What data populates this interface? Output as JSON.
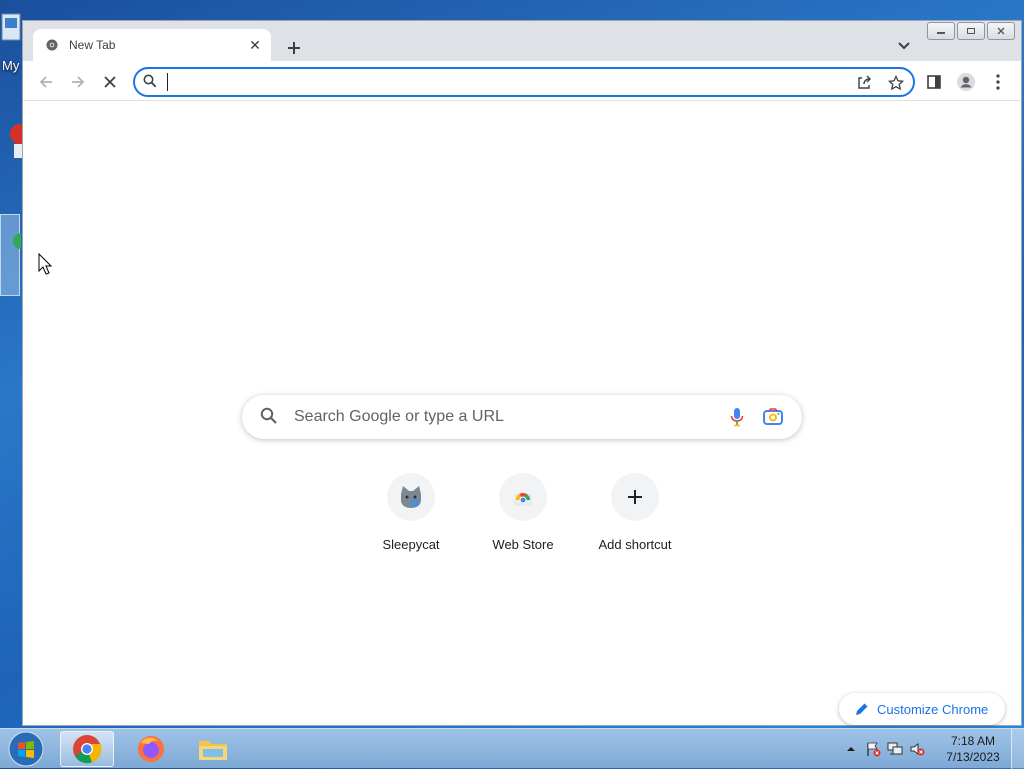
{
  "desktop": {
    "icon_label": "My"
  },
  "tab": {
    "title": "New Tab",
    "favicon": "chrome-favicon"
  },
  "omnibox": {
    "value": "",
    "placeholder": ""
  },
  "ntp": {
    "search_placeholder": "Search Google or type a URL",
    "shortcuts": [
      {
        "label": "Sleepycat",
        "icon": "sleepycat-icon"
      },
      {
        "label": "Web Store",
        "icon": "web-store-icon"
      },
      {
        "label": "Add shortcut",
        "icon": "plus-icon"
      }
    ],
    "customize_label": "Customize Chrome"
  },
  "taskbar": {
    "items": [
      "chrome-icon",
      "firefox-icon",
      "file-explorer-icon"
    ],
    "clock": {
      "time": "7:18 AM",
      "date": "7/13/2023"
    }
  },
  "colors": {
    "accent": "#1a73e8",
    "tab_strip": "#dee1e6"
  }
}
